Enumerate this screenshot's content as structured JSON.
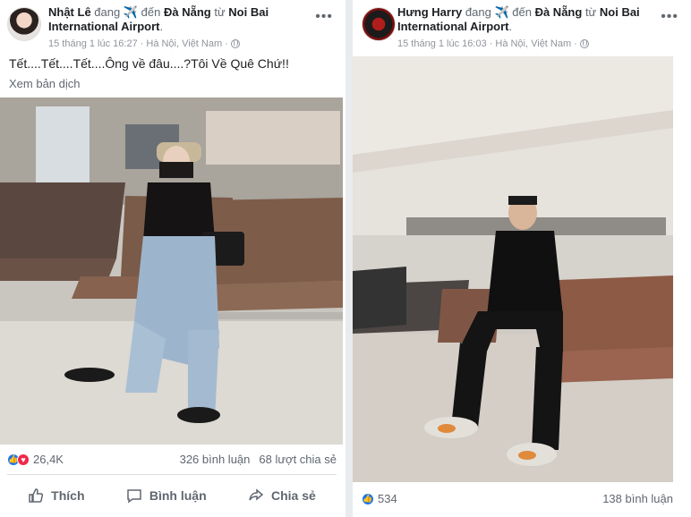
{
  "posts": [
    {
      "author": "Nhật Lê",
      "verb": "đang",
      "activity_icon": "✈️",
      "to_label": "đến",
      "destination": "Đà Nẵng",
      "from_label": "từ",
      "origin": "Noi Bai International Airport",
      "time": "15 tháng 1 lúc 16:27",
      "location": "Hà Nội, Việt Nam",
      "status": "Tết....Tết....Tết....Ông về đâu....?Tôi Về Quê Chứ!!",
      "translate": "Xem bản dịch",
      "reactions": "26,4K",
      "comments": "326 bình luận",
      "shares": "68 lượt chia sẻ",
      "actions": {
        "like": "Thích",
        "comment": "Bình luận",
        "share": "Chia sẻ"
      }
    },
    {
      "author": "Hưng Harry",
      "verb": "đang",
      "activity_icon": "✈️",
      "to_label": "đến",
      "destination": "Đà Nẵng",
      "from_label": "từ",
      "origin": "Noi Bai International Airport",
      "time": "15 tháng 1 lúc 16:03",
      "location": "Hà Nội, Việt Nam",
      "reactions": "534",
      "comments": "138 bình luận"
    }
  ],
  "colors": {
    "brand": "#1877f2",
    "love": "#f0284a",
    "background": "#e9ebee"
  }
}
